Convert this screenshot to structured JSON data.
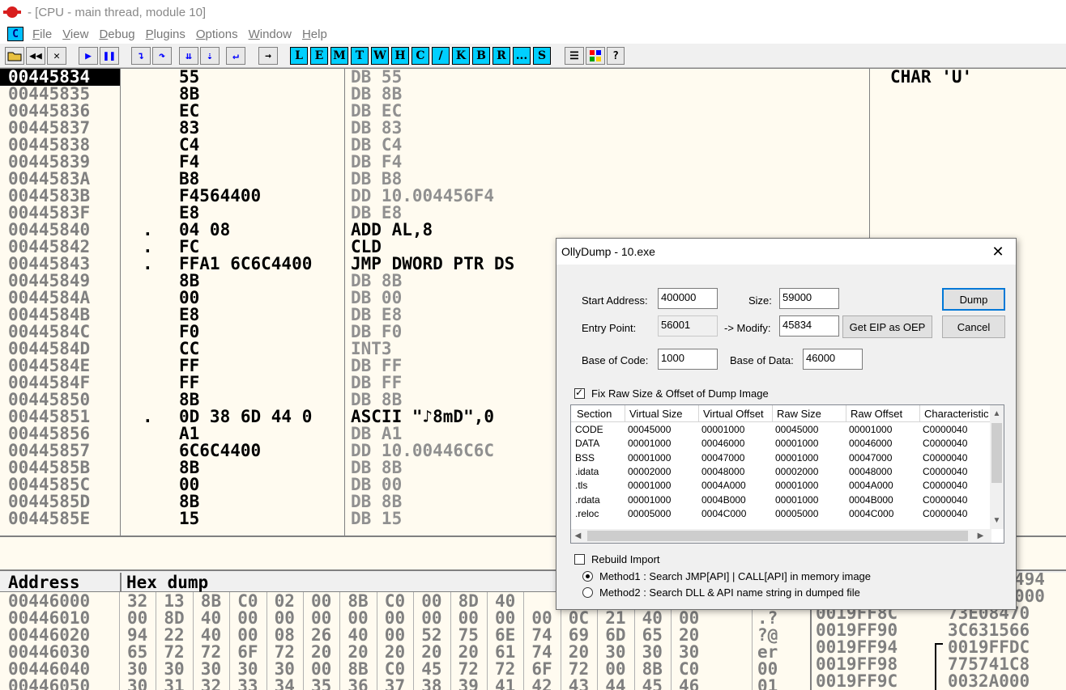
{
  "window": {
    "title": "- [CPU - main thread, module 10]"
  },
  "menu": {
    "c_icon": "C",
    "items": [
      {
        "u": "F",
        "rest": "ile"
      },
      {
        "u": "V",
        "rest": "iew"
      },
      {
        "u": "D",
        "rest": "ebug"
      },
      {
        "u": "P",
        "rest": "lugins"
      },
      {
        "u": "O",
        "rest": "ptions"
      },
      {
        "u": "W",
        "rest": "indow"
      },
      {
        "u": "H",
        "rest": "elp"
      }
    ]
  },
  "toolbar": {
    "letters": [
      "L",
      "E",
      "M",
      "T",
      "W",
      "H",
      "C",
      "/",
      "K",
      "B",
      "R",
      "...",
      "S"
    ],
    "help": "?"
  },
  "code": {
    "comment": "CHAR 'U'",
    "rows": [
      {
        "addr": "00445834",
        "mark": "",
        "hex": "55",
        "dis": "DB 55",
        "kind": "db"
      },
      {
        "addr": "00445835",
        "mark": "",
        "hex": "8B",
        "dis": "DB 8B",
        "kind": "db"
      },
      {
        "addr": "00445836",
        "mark": "",
        "hex": "EC",
        "dis": "DB EC",
        "kind": "db"
      },
      {
        "addr": "00445837",
        "mark": "",
        "hex": "83",
        "dis": "DB 83",
        "kind": "db"
      },
      {
        "addr": "00445838",
        "mark": "",
        "hex": "C4",
        "dis": "DB C4",
        "kind": "db"
      },
      {
        "addr": "00445839",
        "mark": "",
        "hex": "F4",
        "dis": "DB F4",
        "kind": "db"
      },
      {
        "addr": "0044583A",
        "mark": "",
        "hex": "B8",
        "dis": "DB B8",
        "kind": "db"
      },
      {
        "addr": "0044583B",
        "mark": "",
        "hex": "F4564400",
        "dis": "DD 10.004456F4",
        "kind": "db"
      },
      {
        "addr": "0044583F",
        "mark": "",
        "hex": "E8",
        "dis": "DB E8",
        "kind": "db"
      },
      {
        "addr": "00445840",
        "mark": ".",
        "hex": "04 08",
        "dis": "ADD AL,8",
        "kind": "real"
      },
      {
        "addr": "00445842",
        "mark": ".",
        "hex": "FC",
        "dis": "CLD",
        "kind": "real"
      },
      {
        "addr": "00445843",
        "mark": ".",
        "hex": "FFA1 6C6C4400",
        "dis": "JMP DWORD PTR DS",
        "kind": "real"
      },
      {
        "addr": "00445849",
        "mark": "",
        "hex": "8B",
        "dis": "DB 8B",
        "kind": "db"
      },
      {
        "addr": "0044584A",
        "mark": "",
        "hex": "00",
        "dis": "DB 00",
        "kind": "db"
      },
      {
        "addr": "0044584B",
        "mark": "",
        "hex": "E8",
        "dis": "DB E8",
        "kind": "db"
      },
      {
        "addr": "0044584C",
        "mark": "",
        "hex": "F0",
        "dis": "DB F0",
        "kind": "db"
      },
      {
        "addr": "0044584D",
        "mark": "",
        "hex": "CC",
        "dis": "INT3",
        "kind": "db"
      },
      {
        "addr": "0044584E",
        "mark": "",
        "hex": "FF",
        "dis": "DB FF",
        "kind": "db"
      },
      {
        "addr": "0044584F",
        "mark": "",
        "hex": "FF",
        "dis": "DB FF",
        "kind": "db"
      },
      {
        "addr": "00445850",
        "mark": "",
        "hex": "8B",
        "dis": "DB 8B",
        "kind": "db"
      },
      {
        "addr": "00445851",
        "mark": ".",
        "hex": "0D 38 6D 44 0",
        "dis": "ASCII \"♪8mD\",0",
        "kind": "real"
      },
      {
        "addr": "00445856",
        "mark": "",
        "hex": "A1",
        "dis": "DB A1",
        "kind": "db"
      },
      {
        "addr": "00445857",
        "mark": "",
        "hex": "6C6C4400",
        "dis": "DD 10.00446C6C",
        "kind": "db"
      },
      {
        "addr": "0044585B",
        "mark": "",
        "hex": "8B",
        "dis": "DB 8B",
        "kind": "db"
      },
      {
        "addr": "0044585C",
        "mark": "",
        "hex": "00",
        "dis": "DB 00",
        "kind": "db"
      },
      {
        "addr": "0044585D",
        "mark": "",
        "hex": "8B",
        "dis": "DB 8B",
        "kind": "db"
      },
      {
        "addr": "0044585E",
        "mark": "",
        "hex": "15",
        "dis": "DB 15",
        "kind": "db"
      }
    ]
  },
  "dump": {
    "header_address": "Address",
    "header_hex": "Hex dump",
    "rows": [
      {
        "addr": "00446000",
        "bytes": [
          "32",
          "13",
          "8B",
          "C0",
          "02",
          "00",
          "8B",
          "C0",
          "00",
          "8D",
          "40"
        ],
        "ascii": ""
      },
      {
        "addr": "00446010",
        "bytes": [
          "00",
          "8D",
          "40",
          "00",
          "00",
          "00",
          "00",
          "00",
          "00",
          "00",
          "00",
          "00",
          "0C",
          "21",
          "40",
          "00"
        ],
        "ascii": ".?"
      },
      {
        "addr": "00446020",
        "bytes": [
          "94",
          "22",
          "40",
          "00",
          "08",
          "26",
          "40",
          "00",
          "52",
          "75",
          "6E",
          "74",
          "69",
          "6D",
          "65",
          "20"
        ],
        "ascii": "?@"
      },
      {
        "addr": "00446030",
        "bytes": [
          "65",
          "72",
          "72",
          "6F",
          "72",
          "20",
          "20",
          "20",
          "20",
          "20",
          "61",
          "74",
          "20",
          "30",
          "30",
          "30"
        ],
        "ascii": "er"
      },
      {
        "addr": "00446040",
        "bytes": [
          "30",
          "30",
          "30",
          "30",
          "30",
          "00",
          "8B",
          "C0",
          "45",
          "72",
          "72",
          "6F",
          "72",
          "00",
          "8B",
          "C0"
        ],
        "ascii": "00"
      },
      {
        "addr": "00446050",
        "bytes": [
          "30",
          "31",
          "32",
          "33",
          "34",
          "35",
          "36",
          "37",
          "38",
          "39",
          "41",
          "42",
          "43",
          "44",
          "45",
          "46"
        ],
        "ascii": "01"
      }
    ]
  },
  "stack": {
    "rows": [
      {
        "addr": "",
        "val": "494"
      },
      {
        "addr": "",
        "val": "000"
      },
      {
        "addr": "0019FF8C",
        "val": "73E08470"
      },
      {
        "addr": "0019FF90",
        "val": "3C631566"
      },
      {
        "addr": "0019FF94",
        "val": "0019FFDC"
      },
      {
        "addr": "0019FF98",
        "val": "775741C8"
      },
      {
        "addr": "0019FF9C",
        "val": "0032A000"
      }
    ]
  },
  "dialog": {
    "title": "OllyDump - 10.exe",
    "close": "✕",
    "start_address_label": "Start Address:",
    "start_address": "400000",
    "size_label": "Size:",
    "size": "59000",
    "entry_point_label": "Entry Point:",
    "entry_point": "56001",
    "modify_label": "-> Modify:",
    "modify": "45834",
    "get_eip_button": "Get EIP as OEP",
    "base_code_label": "Base of Code:",
    "base_code": "1000",
    "base_data_label": "Base of Data:",
    "base_data": "46000",
    "dump_button": "Dump",
    "cancel_button": "Cancel",
    "fix_raw_label": "Fix Raw Size & Offset of Dump Image",
    "fix_raw_checked": true,
    "columns": [
      "Section",
      "Virtual Size",
      "Virtual Offset",
      "Raw Size",
      "Raw Offset",
      "Characteristic"
    ],
    "sections": [
      [
        "CODE",
        "00045000",
        "00001000",
        "00045000",
        "00001000",
        "C0000040"
      ],
      [
        "DATA",
        "00001000",
        "00046000",
        "00001000",
        "00046000",
        "C0000040"
      ],
      [
        "BSS",
        "00001000",
        "00047000",
        "00001000",
        "00047000",
        "C0000040"
      ],
      [
        ".idata",
        "00002000",
        "00048000",
        "00002000",
        "00048000",
        "C0000040"
      ],
      [
        ".tls",
        "00001000",
        "0004A000",
        "00001000",
        "0004A000",
        "C0000040"
      ],
      [
        ".rdata",
        "00001000",
        "0004B000",
        "00001000",
        "0004B000",
        "C0000040"
      ],
      [
        ".reloc",
        "00005000",
        "0004C000",
        "00005000",
        "0004C000",
        "C0000040"
      ]
    ],
    "rebuild_import_label": "Rebuild Import",
    "rebuild_import_checked": false,
    "method1_label": "Method1 : Search JMP[API] | CALL[API] in memory image",
    "method2_label": "Method2 : Search DLL & API name string in dumped file"
  }
}
